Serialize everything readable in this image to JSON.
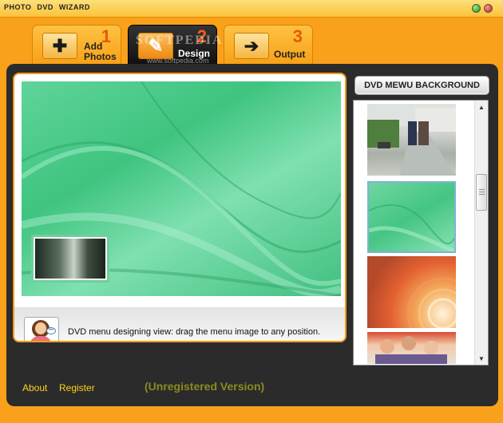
{
  "window": {
    "title": "PHOTO  DVD  WIZARD"
  },
  "tabs": [
    {
      "label": "Add\nPhotos",
      "number": "1",
      "icon": "plus-icon"
    },
    {
      "label": "Design",
      "number": "2",
      "icon": "brush-icon"
    },
    {
      "label": "Output",
      "number": "3",
      "icon": "arrow-icon"
    }
  ],
  "watermark": {
    "text": "SOFTPEDIA",
    "sub": "www.softpedia.com"
  },
  "right_panel": {
    "button_label": "DVD MEWU BACKGROUND"
  },
  "info": {
    "text": "DVD menu designing view: drag the menu image to any position."
  },
  "footer": {
    "about": "About",
    "register": "Register",
    "status": "(Unregistered Version)"
  },
  "colors": {
    "frame": "#f9a11b",
    "panel": "#2b2b2b",
    "accent_link": "#ffd21a",
    "status_text": "#8d8a20"
  }
}
